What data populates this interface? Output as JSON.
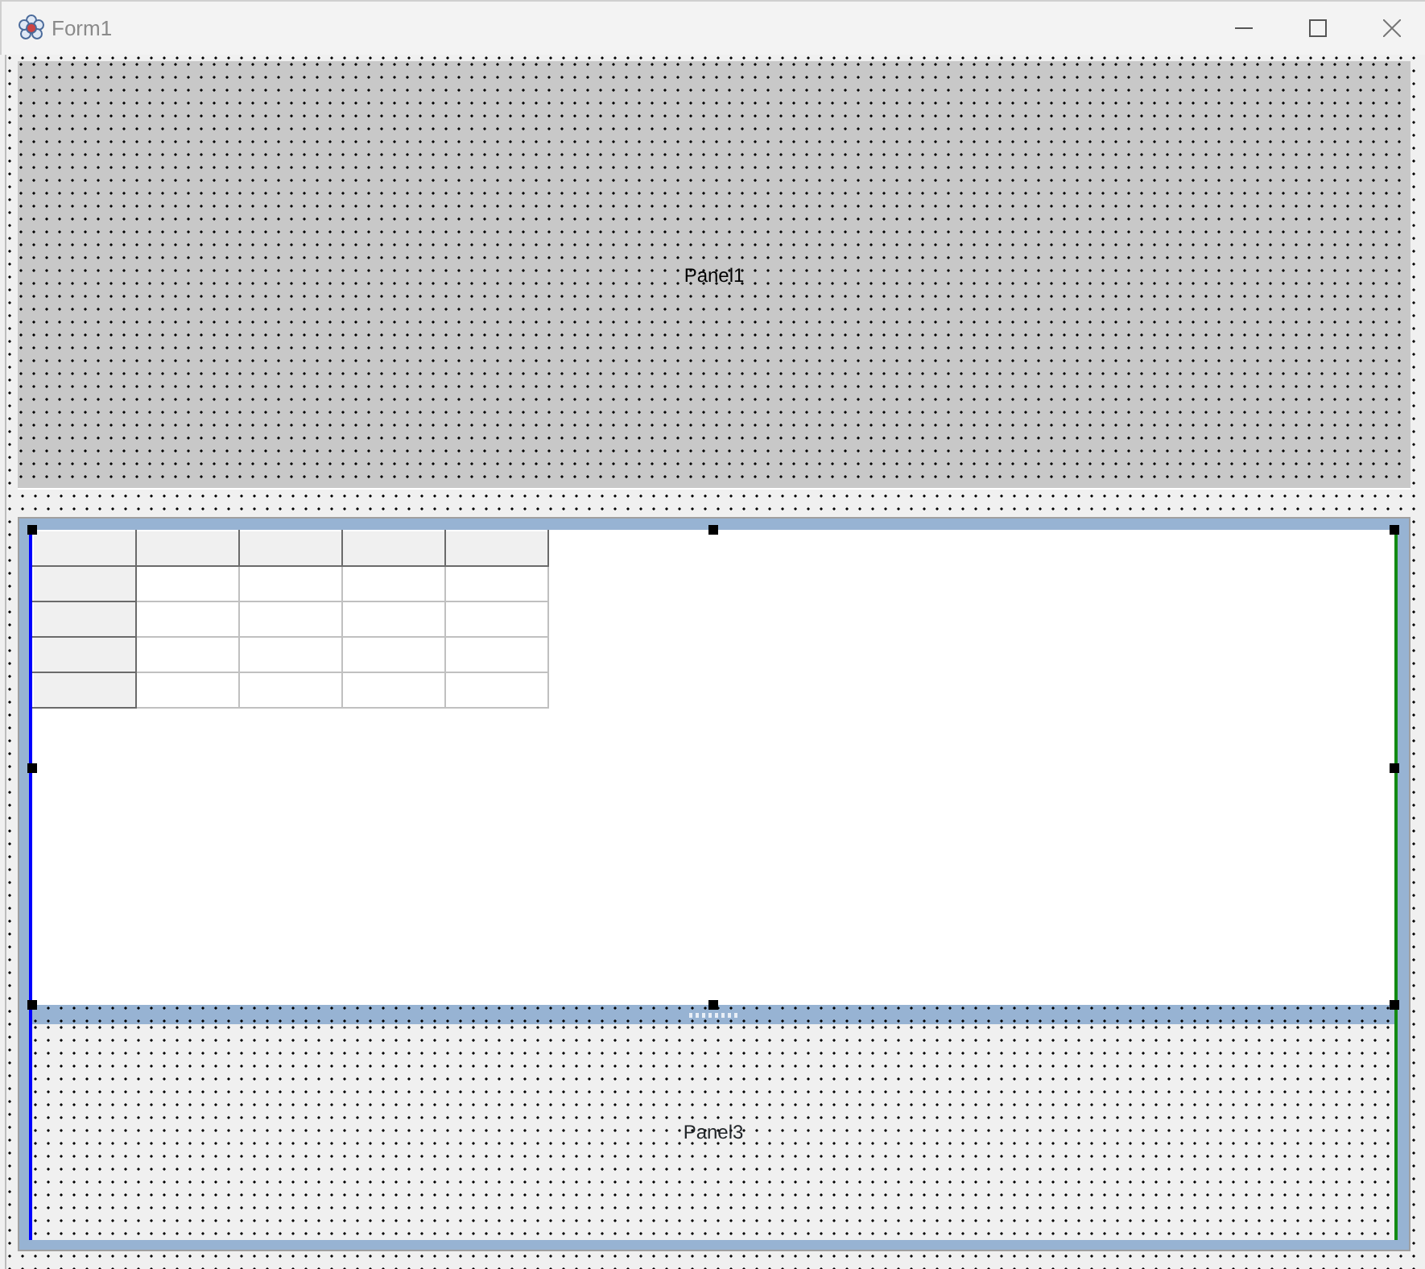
{
  "window": {
    "title": "Form1"
  },
  "panel_top": {
    "caption": "Panel1"
  },
  "string_grid": {
    "selected": true
  },
  "panel_bottom": {
    "caption": "Panel3"
  }
}
